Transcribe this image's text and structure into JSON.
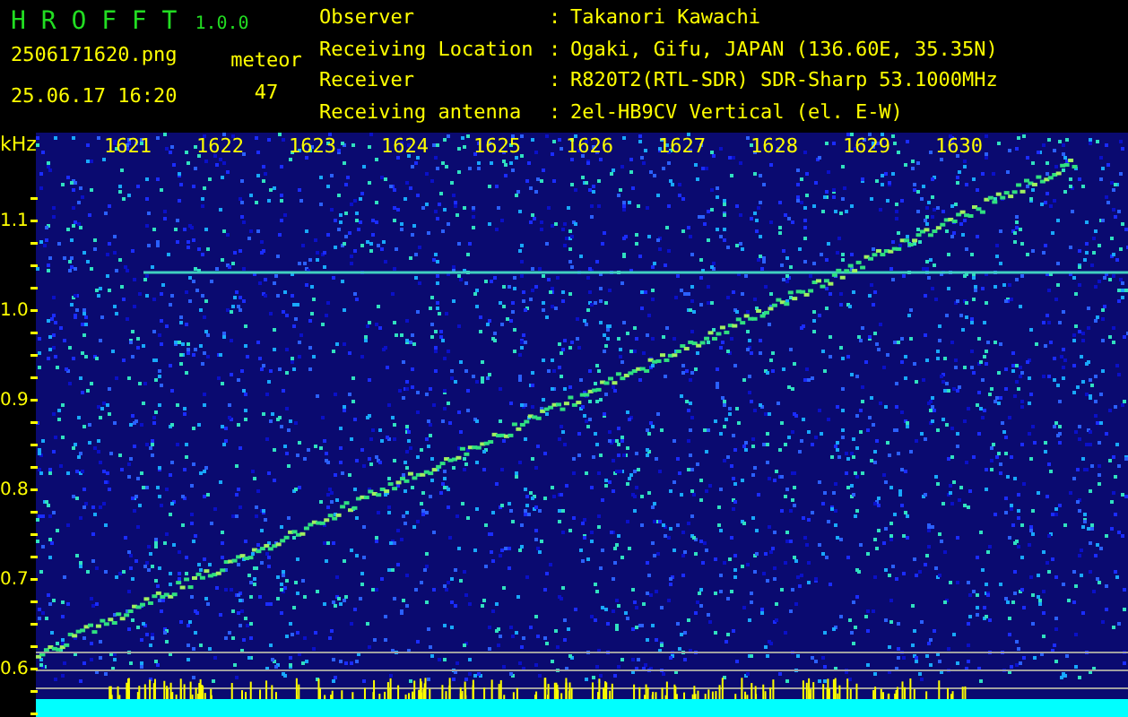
{
  "app": {
    "name": "H R O F F T",
    "version": "1.0.0"
  },
  "file": {
    "name": "2506171620.png",
    "timestamp": "25.06.17 16:20"
  },
  "counter": {
    "label": "meteor",
    "value": "47"
  },
  "station_info": [
    {
      "label": "Observer",
      "separator": ":",
      "value": "Takanori Kawachi"
    },
    {
      "label": "Receiving Location",
      "separator": ":",
      "value": "Ogaki, Gifu, JAPAN (136.60E, 35.35N)"
    },
    {
      "label": "Receiver",
      "separator": ":",
      "value": "R820T2(RTL-SDR) SDR-Sharp 53.1000MHz"
    },
    {
      "label": "Receiving antenna",
      "separator": ":",
      "value": "2el-HB9CV Vertical (el. E-W)"
    }
  ],
  "spectrogram": {
    "unit": "kHz",
    "x_labels": [
      "1621",
      "1622",
      "1623",
      "1624",
      "1625",
      "1626",
      "1627",
      "1628",
      "1629",
      "1630"
    ],
    "y_labels": [
      "1.1",
      "1.0",
      "0.9",
      "0.8",
      "0.7",
      "0.6"
    ]
  }
}
